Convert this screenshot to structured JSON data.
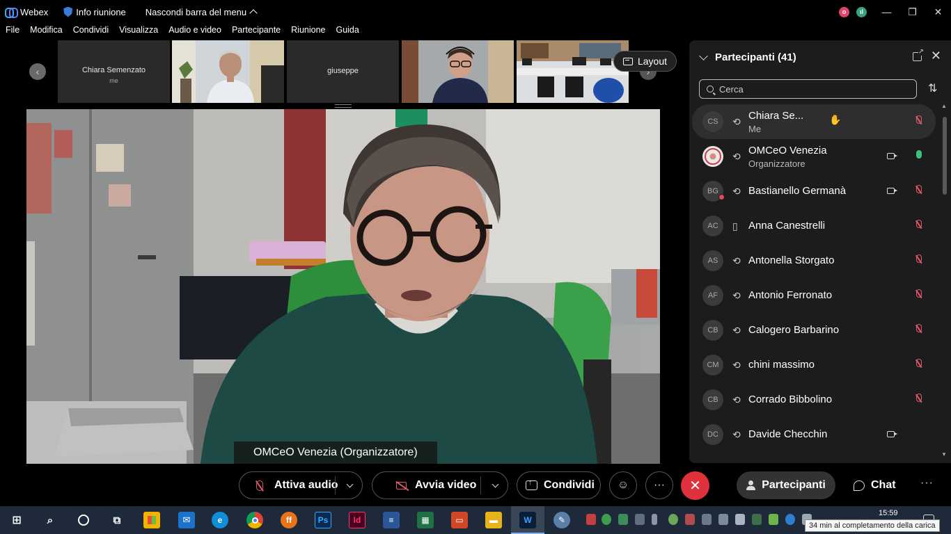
{
  "titlebar": {
    "app_name": "Webex",
    "meeting_info": "Info riunione",
    "hide_menu": "Nascondi barra del menu"
  },
  "menu": [
    "File",
    "Modifica",
    "Condividi",
    "Visualizza",
    "Audio e video",
    "Partecipante",
    "Riunione",
    "Guida"
  ],
  "filmstrip": {
    "tiles": [
      {
        "name": "Chiara Semenzato",
        "sub": "me",
        "type": "name"
      },
      {
        "name": "",
        "type": "video"
      },
      {
        "name": "giuseppe",
        "type": "name"
      },
      {
        "name": "",
        "type": "video"
      },
      {
        "name": "",
        "type": "video"
      }
    ],
    "layout_label": "Layout"
  },
  "stage": {
    "speaker_label": "OMCeO Venezia (Organizzatore)"
  },
  "panel": {
    "title": "Partecipanti (41)",
    "search_placeholder": "Cerca",
    "participants": [
      {
        "initials": "CS",
        "name": "Chiara Se...",
        "role": "Me",
        "device": "web",
        "hand": true,
        "video": false,
        "mic": "muted"
      },
      {
        "initials": "",
        "name": "OMCeO Venezia",
        "role": "Organizzatore",
        "device": "web",
        "hand": false,
        "video": true,
        "mic": "on"
      },
      {
        "initials": "BG",
        "name": "Bastianello Germanà",
        "role": "",
        "device": "web",
        "hand": false,
        "video": true,
        "mic": "muted"
      },
      {
        "initials": "AC",
        "name": "Anna Canestrelli",
        "role": "",
        "device": "mobile",
        "hand": false,
        "video": false,
        "mic": "muted"
      },
      {
        "initials": "AS",
        "name": "Antonella Storgato",
        "role": "",
        "device": "web",
        "hand": false,
        "video": false,
        "mic": "muted"
      },
      {
        "initials": "AF",
        "name": "Antonio Ferronato",
        "role": "",
        "device": "web",
        "hand": false,
        "video": false,
        "mic": "muted"
      },
      {
        "initials": "CB",
        "name": "Calogero Barbarino",
        "role": "",
        "device": "web",
        "hand": false,
        "video": false,
        "mic": "muted"
      },
      {
        "initials": "CM",
        "name": "chini massimo",
        "role": "",
        "device": "web",
        "hand": false,
        "video": false,
        "mic": "muted"
      },
      {
        "initials": "CB",
        "name": "Corrado Bibbolino",
        "role": "",
        "device": "web",
        "hand": false,
        "video": false,
        "mic": "muted"
      },
      {
        "initials": "DC",
        "name": "Davide Checchin",
        "role": "",
        "device": "web",
        "hand": false,
        "video": true,
        "mic": "none"
      }
    ]
  },
  "controls": {
    "audio": "Attiva audio",
    "video": "Avvia video",
    "share": "Condividi",
    "participants": "Partecipanti",
    "chat": "Chat"
  },
  "taskbar": {
    "time": "15:59",
    "tooltip": "34 min al completamento della carica"
  },
  "colors": {
    "muted": "#e05a6a",
    "unmuted": "#3fbf7f",
    "end_call": "#e0323c",
    "taskbar": "#1e2a3a"
  }
}
